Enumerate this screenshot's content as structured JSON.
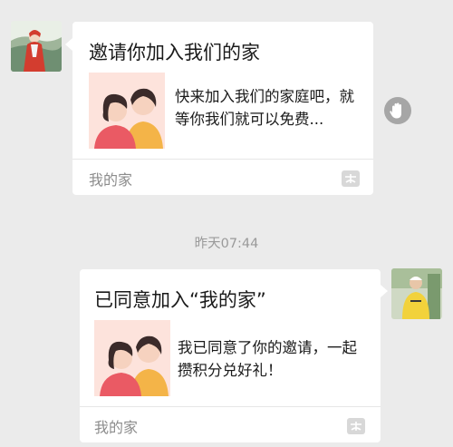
{
  "messages": [
    {
      "title": "邀请你加入我们的家",
      "description": "快来加入我们的家庭吧，就等你我们就可以免费...",
      "source": "我的家",
      "app_icon": "app-icon"
    },
    {
      "title": "已同意加入“我的家”",
      "description": "我已同意了你的邀请，一起攒积分兑好礼！",
      "source": "我的家",
      "app_icon": "app-icon"
    }
  ],
  "timestamp": "昨天07:44",
  "icons": {
    "reaction": "hand-wave-icon"
  },
  "colors": {
    "background": "#ebebeb",
    "card": "#ffffff",
    "source_text": "#8c8c8c"
  }
}
